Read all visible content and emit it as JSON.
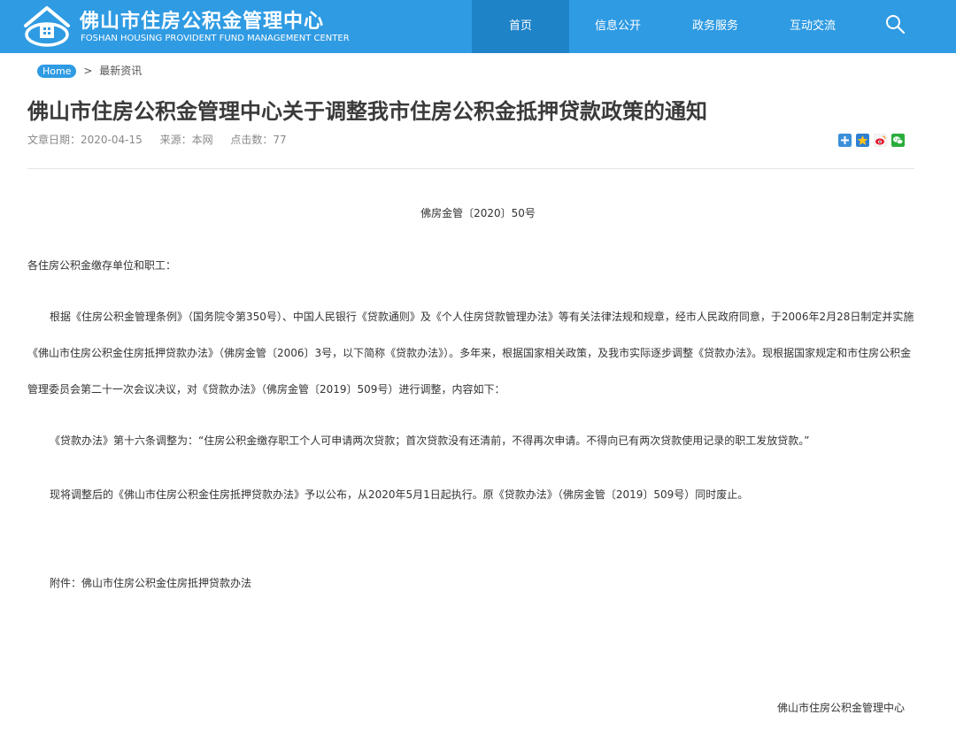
{
  "header": {
    "title": "佛山市住房公积金管理中心",
    "subtitle": "FOSHAN HOUSING PROVIDENT FUND MANAGEMENT CENTER",
    "logo_icon": "house-logo-icon",
    "search_icon": "search-icon"
  },
  "nav": {
    "items": [
      {
        "label": "首页",
        "active": true
      },
      {
        "label": "信息公开",
        "active": false
      },
      {
        "label": "政务服务",
        "active": false
      },
      {
        "label": "互动交流",
        "active": false
      }
    ]
  },
  "breadcrumb": {
    "home": "Home",
    "separator": ">",
    "current": "最新资讯"
  },
  "article": {
    "title": "佛山市住房公积金管理中心关于调整我市住房公积金抵押贷款政策的通知",
    "meta": {
      "date": "文章日期：2020-04-15",
      "source": "来源：本网",
      "views": "点击数：77"
    },
    "doc_number": "佛房金管〔2020〕50号",
    "salutation": "各住房公积金缴存单位和职工：",
    "paragraph_main": "根据《住房公积金管理条例》（国务院令第350号）、中国人民银行《贷款通则》及《个人住房贷款管理办法》等有关法律法规和规章，经市人民政府同意，于2006年2月28日制定并实施《佛山市住房公积金住房抵押贷款办法》（佛房金管〔2006〕3号，以下简称《贷款办法》）。多年来，根据国家相关政策，及我市实际逐步调整《贷款办法》。现根据国家规定和市住房公积金管理委员会第二十一次会议决议，对《贷款办法》（佛房金管〔2019〕509号）进行调整，内容如下：",
    "paragraph_quote": "《贷款办法》第十六条调整为：“住房公积金缴存职工个人可申请两次贷款；首次贷款没有还清前，不得再次申请。不得向已有两次贷款使用记录的职工发放贷款。”",
    "paragraph_publish": "现将调整后的《佛山市住房公积金住房抵押贷款办法》予以公布，从2020年5月1日起执行。原《贷款办法》（佛房金管〔2019〕509号）同时废止。",
    "attachment": "附件：佛山市住房公积金住房抵押贷款办法",
    "signature": "佛山市住房公积金管理中心"
  },
  "share": {
    "icons": [
      "share-plus-icon",
      "qzone-icon",
      "weibo-icon",
      "wechat-icon"
    ]
  },
  "colors": {
    "header_bg": "#2f9be3",
    "nav_active_bg": "#1f83c8"
  }
}
